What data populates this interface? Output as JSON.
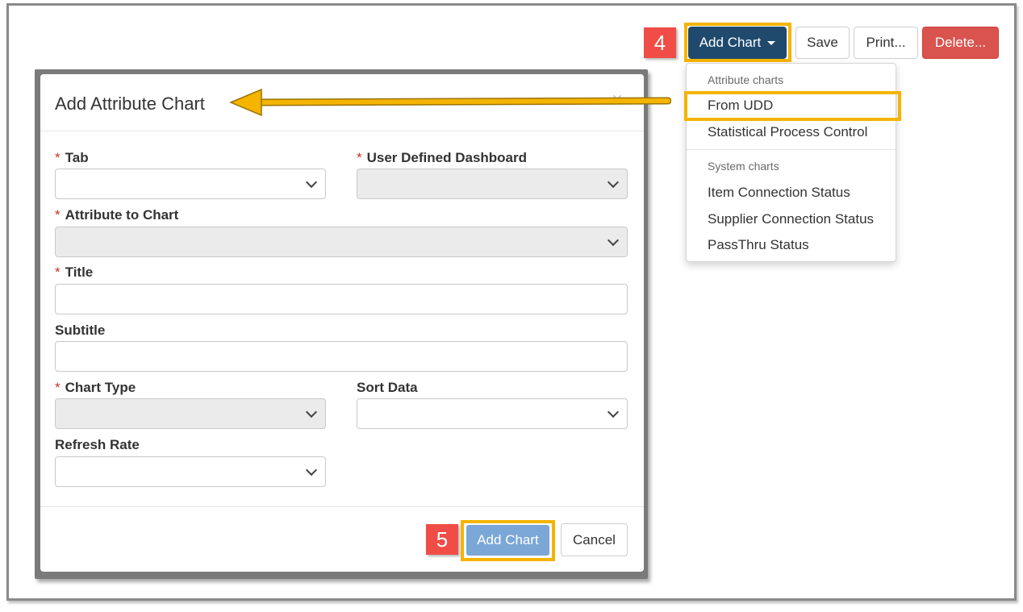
{
  "toolbar": {
    "add_chart_label": "Add Chart",
    "save_label": "Save",
    "print_label": "Print...",
    "delete_label": "Delete..."
  },
  "steps": {
    "step4": "4",
    "step5": "5"
  },
  "dropdown": {
    "attribute_header": "Attribute charts",
    "attribute_items": [
      "From UDD",
      "Statistical Process Control"
    ],
    "system_header": "System charts",
    "system_items": [
      "Item Connection Status",
      "Supplier Connection Status",
      "PassThru Status"
    ]
  },
  "modal": {
    "title": "Add Attribute Chart",
    "close_glyph": "×",
    "required_mark": "*",
    "fields": {
      "tab": {
        "label": "Tab",
        "value": ""
      },
      "udd": {
        "label": "User Defined Dashboard",
        "value": ""
      },
      "attribute": {
        "label": "Attribute to Chart",
        "value": ""
      },
      "title": {
        "label": "Title",
        "value": ""
      },
      "subtitle": {
        "label": "Subtitle",
        "value": ""
      },
      "chart_type": {
        "label": "Chart Type",
        "value": ""
      },
      "sort_data": {
        "label": "Sort Data",
        "value": ""
      },
      "refresh_rate": {
        "label": "Refresh Rate",
        "value": ""
      }
    },
    "add_chart_label": "Add Chart",
    "cancel_label": "Cancel"
  },
  "colors": {
    "highlight": "#f5b400",
    "step_badge": "#f04d46",
    "primary_button": "#1f4a6e",
    "danger_button": "#d9534f",
    "disabled_button": "#7ba7d6"
  }
}
